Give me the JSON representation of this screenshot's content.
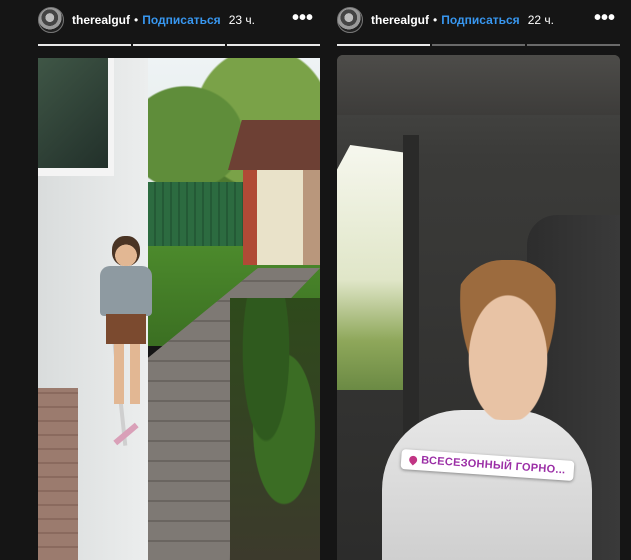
{
  "stories": [
    {
      "username": "therealguf",
      "separator": "•",
      "follow_label": "Подписаться",
      "time": "23 ч.",
      "more_label": "•••",
      "progress": {
        "segments": 3,
        "completed": 3
      }
    },
    {
      "username": "therealguf",
      "separator": "•",
      "follow_label": "Подписаться",
      "time": "22 ч.",
      "more_label": "•••",
      "progress": {
        "segments": 3,
        "completed": 1
      },
      "location_sticker": "ВСЕСЕЗОННЫЙ ГОРНО..."
    }
  ],
  "colors": {
    "background": "#151515",
    "follow_link": "#3897f0",
    "sticker_text": "#9b2ea6"
  }
}
